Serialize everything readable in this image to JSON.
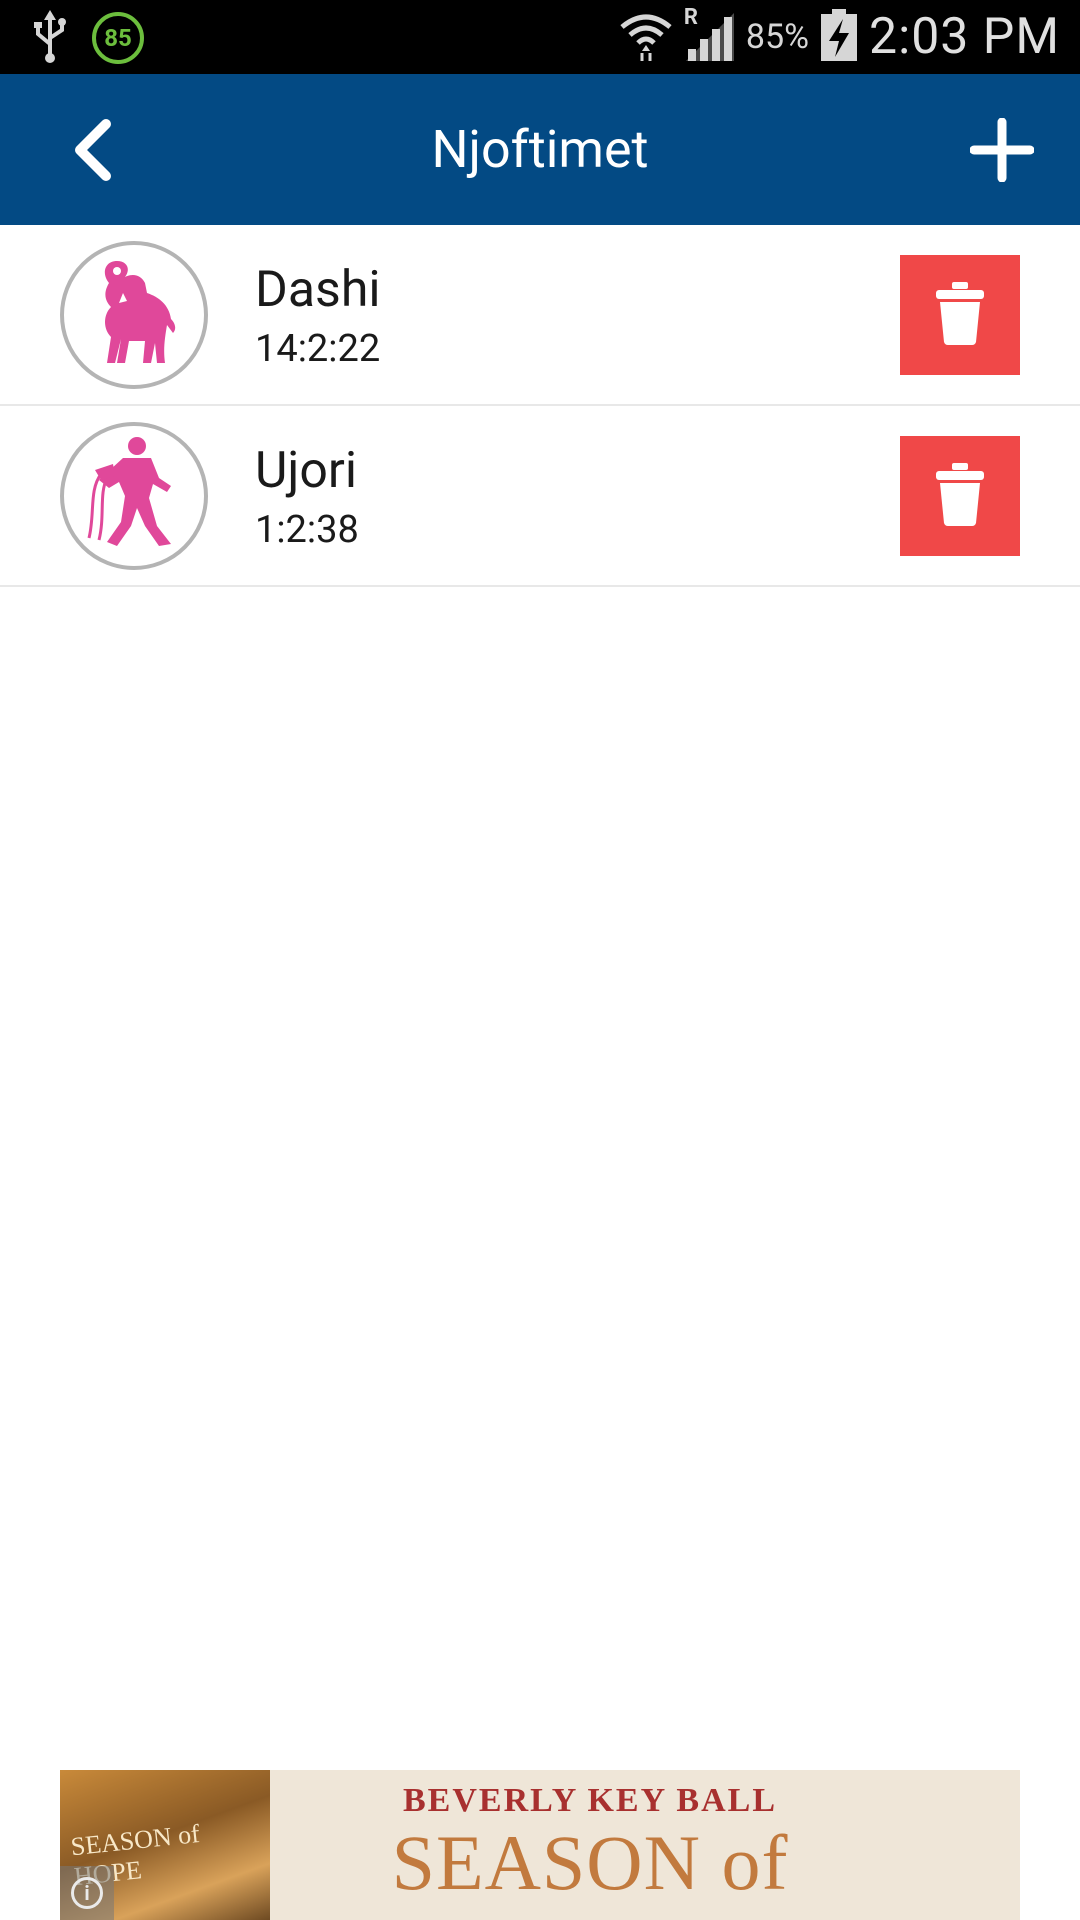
{
  "status_bar": {
    "notification_badge": "85",
    "battery_percent": "85%",
    "network_badge": "R",
    "time": "2:03 PM"
  },
  "app_bar": {
    "title": "Njoftimet",
    "back_icon": "chevron-left-icon",
    "add_icon": "plus-icon"
  },
  "list": {
    "items": [
      {
        "name": "Dashi",
        "time": "14:2:22",
        "icon": "aries-icon"
      },
      {
        "name": "Ujori",
        "time": "1:2:38",
        "icon": "aquarius-icon"
      }
    ]
  },
  "ad": {
    "author": "BEVERLY KEY BALL",
    "title": "SEASON of HOPE",
    "book_title": "SEASON of HOPE"
  },
  "colors": {
    "app_bar": "#034a84",
    "delete_button": "#f04848",
    "zodiac_pink": "#e0489a"
  }
}
